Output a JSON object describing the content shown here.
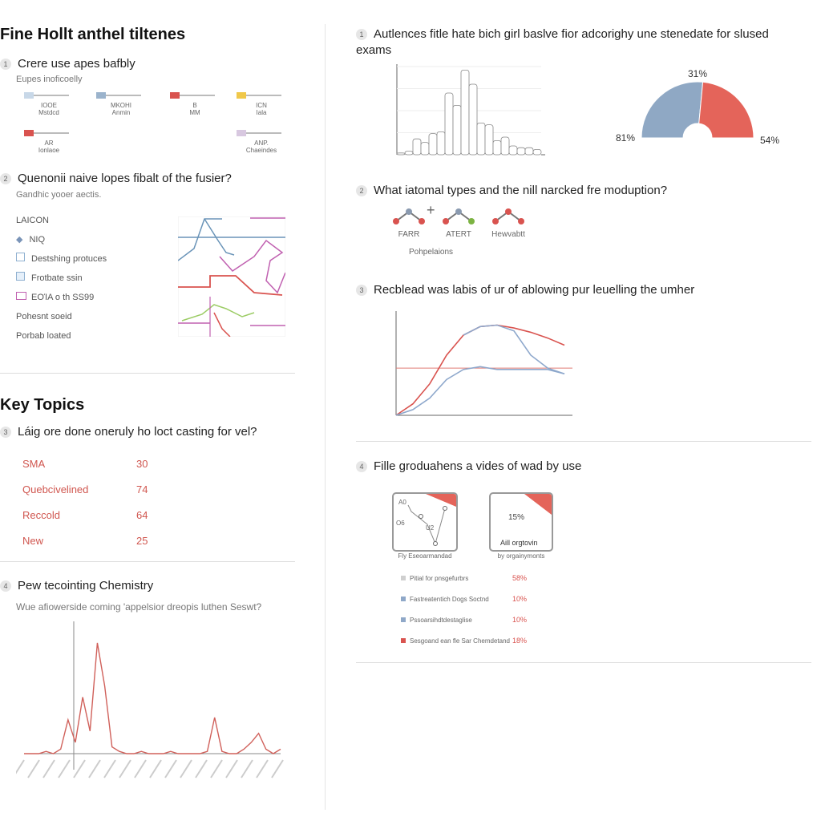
{
  "left": {
    "title": "Fine Hollt anthel tiltenes",
    "q1": {
      "num": "1",
      "text": "Crere use apes bafbly",
      "sub": "Eupes inoficoelly",
      "items": [
        {
          "top": "ΙΟΟΕ",
          "bottom": "Mstdcd",
          "color": "#c8d8e8"
        },
        {
          "top": "ΜΚΟΗΙ",
          "bottom": "Anmin",
          "color": "#9bb3cc"
        },
        {
          "top": "B",
          "bottom": "MM",
          "color": "#d9534f"
        },
        {
          "top": "ICN",
          "bottom": "Iala",
          "color": "#f0c84a"
        },
        {
          "top": "AR",
          "bottom": "Ionlaoe",
          "color": "#d9534f"
        },
        {
          "top": "ANP.",
          "bottom": "Chaeindes",
          "color": "#d8c8e0"
        }
      ]
    },
    "q2": {
      "num": "2",
      "text": "Quenonii naive lopes fibalt of the fusier?",
      "sub": "Gandhic yooer aectis.",
      "list": [
        "LAICON",
        "NIQ",
        "Destshing protuces",
        "Frotbate ssin",
        "EOΊA o th SS99",
        "Pohesnt soeid",
        "Porbab loated"
      ]
    },
    "key_title": "Key Topics",
    "q3": {
      "num": "3",
      "text": "Láig ore done oneruly ho loct casting for vel?",
      "rows": [
        {
          "label": "SMA",
          "value": "30"
        },
        {
          "label": "Quebcivelined",
          "value": "74"
        },
        {
          "label": "Reccold",
          "value": "64"
        },
        {
          "label": "New",
          "value": "25"
        }
      ]
    },
    "q4": {
      "num": "4",
      "text": "Pew tecointing Chemistry",
      "sub": "Wue afiowerside coming 'appelsior dreopis luthen Seswt?"
    }
  },
  "right": {
    "q1": {
      "num": "1",
      "text": "Autlences fitle hate bich girl baslve fior adcorighy une stenedate for slused exams"
    },
    "q2": {
      "num": "2",
      "text": "What iatomal types and the nill narcked fre moduption?",
      "molecules": [
        "FARR",
        "ATERT",
        "Hewvabtt"
      ],
      "caption": "Pohpelaions"
    },
    "q3": {
      "num": "3",
      "text": "Recblead was labis of ur of ablowing pur leuelling the umher"
    },
    "q4": {
      "num": "4",
      "text": "Fille groduahens a vides of wad by use",
      "card1": {
        "labels": [
          "A0",
          "O6",
          "U2"
        ],
        "caption": "Fly Eseoarmandad"
      },
      "card2": {
        "value": "15%",
        "label": "Aill orgtovin",
        "caption": "by orgainymonts"
      },
      "legend": [
        {
          "label": "Pitial for pnsgefurbrs",
          "value": "58%",
          "color": "#cfcfcf"
        },
        {
          "label": "Fastreatentich Dogs Soctnd",
          "value": "10%",
          "color": "#8fa8c8"
        },
        {
          "label": "Pssoarsihdtdestaglise",
          "value": "10%",
          "color": "#8fa8c8"
        },
        {
          "label": "Sesgoand ean fle Sar Chemdetand",
          "value": "18%",
          "color": "#d9534f"
        }
      ]
    }
  },
  "chart_data": [
    {
      "type": "area",
      "name": "histogram",
      "values": [
        1,
        2,
        9,
        7,
        12,
        13,
        35,
        28,
        48,
        40,
        18,
        17,
        8,
        10,
        5,
        4,
        4,
        3
      ],
      "ylim": [
        0,
        50
      ],
      "grid": true
    },
    {
      "type": "pie",
      "labels": [
        "31%",
        "81%",
        "54%"
      ],
      "slices": [
        {
          "value": 53,
          "color": "#8fa8c4"
        },
        {
          "value": 47,
          "color": "#e4645a"
        }
      ],
      "half_donut": true
    },
    {
      "type": "line",
      "grid": false,
      "series": [
        {
          "color": "#d9534f",
          "values": [
            0,
            0.8,
            2.2,
            4.2,
            5.6,
            6.2,
            6.3,
            6.1,
            5.8,
            5.4,
            4.9
          ]
        },
        {
          "color": "#8ea8cc",
          "values": [
            0,
            0.4,
            1.2,
            2.5,
            3.2,
            3.4,
            3.2,
            3.2,
            3.2,
            3.2,
            2.9
          ]
        },
        {
          "color": "#8ea8cc",
          "values": [
            null,
            null,
            null,
            null,
            5.6,
            6.2,
            6.3,
            5.9,
            4.2,
            3.3,
            2.9
          ]
        }
      ],
      "reference": 3.3,
      "ylim": [
        0,
        7
      ]
    },
    {
      "type": "line",
      "name": "spectrum",
      "values": [
        0,
        0,
        0,
        0.1,
        0,
        0.2,
        1.5,
        0.5,
        2.5,
        1,
        4.9,
        3,
        0.3,
        0.1,
        0,
        0,
        0.1,
        0,
        0,
        0,
        0.1,
        0,
        0,
        0,
        0,
        0.1,
        1.6,
        0.1,
        0,
        0,
        0.2,
        0.5,
        0.9,
        0.2,
        0,
        0.2
      ],
      "ylim": [
        0,
        5.5
      ]
    }
  ]
}
